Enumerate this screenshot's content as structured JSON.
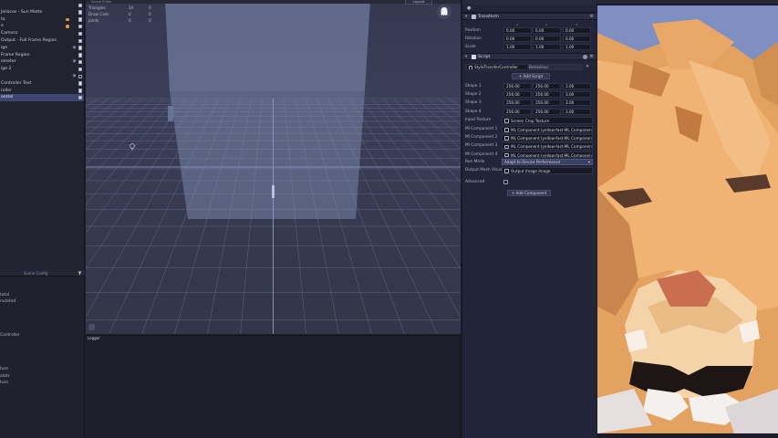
{
  "hierarchy": {
    "items": [
      {
        "label": "",
        "checked": true
      },
      {
        "label": "Jellaces - Sun Matte",
        "checked": true
      },
      {
        "label": "ta",
        "checked": true,
        "dot": true
      },
      {
        "label": "e",
        "checked": true,
        "dot": true
      },
      {
        "label": "Camera",
        "checked": true
      },
      {
        "label": "Output - Full Frame Region",
        "checked": true
      },
      {
        "label": "ige",
        "checked": true,
        "eye": true
      },
      {
        "label": "Frame Region",
        "checked": true
      },
      {
        "label": "ometer",
        "checked": true,
        "eye": true
      },
      {
        "label": "ige 2",
        "checked": true
      },
      {
        "label": "",
        "checked": false,
        "eye": true
      },
      {
        "label": "Controller Text",
        "checked": true
      },
      {
        "label": "roller",
        "checked": true
      },
      {
        "label": "ontrol",
        "checked": true,
        "selected": true
      }
    ]
  },
  "asset_panel": {
    "tab_left": "",
    "tab_right": "Scene Config",
    "items": [
      "tatal",
      "nutated",
      "",
      "",
      "",
      "",
      "Controller",
      "",
      "",
      "",
      "",
      "ture",
      "atals",
      "ture"
    ]
  },
  "viewport": {
    "tab_title": "Scene Editor",
    "layout_label": "Layout",
    "stats": [
      {
        "label": "Triangles",
        "v1": "24",
        "v2": "0"
      },
      {
        "label": "Draw Calls",
        "v1": "0",
        "v2": "0"
      },
      {
        "label": "Joints",
        "v1": "0",
        "v2": "0"
      }
    ]
  },
  "logger": {
    "tab": "Logger"
  },
  "inspector": {
    "transform": {
      "title": "Transform",
      "headers": [
        "x",
        "y",
        "z"
      ],
      "rows": [
        {
          "label": "Position",
          "x": "0.00",
          "y": "0.00",
          "z": "0.00"
        },
        {
          "label": "Rotation",
          "x": "0.00",
          "y": "0.00",
          "z": "0.00"
        },
        {
          "label": "Scale",
          "x": "1.00",
          "y": "1.00",
          "z": "1.00"
        }
      ]
    },
    "script": {
      "title": "Script",
      "object_name": "StyleTransferController",
      "object_sub": "Behaviour",
      "add_button": "Add Script",
      "shapes": [
        {
          "label": "Shape 1",
          "x": "256.00",
          "y": "256.00",
          "z": "3.00"
        },
        {
          "label": "Shape 2",
          "x": "256.00",
          "y": "256.00",
          "z": "3.00"
        },
        {
          "label": "Shape 3",
          "x": "256.00",
          "y": "256.00",
          "z": "3.00"
        },
        {
          "label": "Shape 4",
          "x": "256.00",
          "y": "256.00",
          "z": "3.00"
        }
      ],
      "input_texture": {
        "label": "Input Texture",
        "value": "Screen Crop Texture"
      },
      "ml_components": [
        {
          "label": "Ml Component 1",
          "value": "ML Component (yellow-fast-ML Component)"
        },
        {
          "label": "Ml Component 2",
          "value": "ML Component (yellow-fast-ML Component)"
        },
        {
          "label": "Ml Component 3",
          "value": "ML Component (yellow-fast-ML Component)"
        },
        {
          "label": "Ml Component 4",
          "value": "ML Component (yellow-fast-ML Component)"
        }
      ],
      "run_mode": {
        "label": "Run Mode",
        "value": "Adapt to Device Performance"
      },
      "output_mesh": {
        "label": "Output Mesh Visual",
        "value": "Output Image Image"
      },
      "advanced": {
        "label": "Advanced"
      },
      "add_component": "Add Component"
    }
  },
  "colors": {
    "selection": "#3d4672",
    "accent": "#e49a3c",
    "panel": "#22243a"
  }
}
